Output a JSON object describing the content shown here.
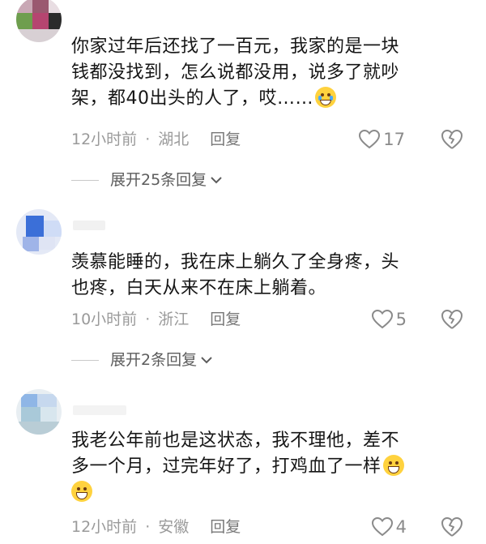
{
  "comments": [
    {
      "text_lines": [
        "你家过年后还找了一百元，我家的是一块",
        "钱都没找到，怎么说都没用，说多了就吵",
        "架，都40出头的人了，哎……"
      ],
      "time": "12小时前",
      "location": "湖北",
      "reply_label": "回复",
      "likes": "17",
      "expand_label": "展开25条回复"
    },
    {
      "text_lines": [
        "羡慕能睡的，我在床上躺久了全身疼，头",
        "也疼，白天从来不在床上躺着。"
      ],
      "time": "10小时前",
      "location": "浙江",
      "reply_label": "回复",
      "likes": "5",
      "expand_label": "展开2条回复"
    },
    {
      "text_lines": [
        "我老公年前也是这状态，我不理他，差不",
        "多一个月，过完年好了，打鸡血了一样"
      ],
      "time": "12小时前",
      "location": "安徽",
      "reply_label": "回复",
      "likes": "4"
    }
  ],
  "colors": {
    "text": "#161616",
    "meta": "#9a9a9a",
    "emoji": "#ffd23e"
  },
  "icons": [
    "heart-icon",
    "broken-heart-icon",
    "chevron-down-icon",
    "crying-emoji",
    "grinning-emoji"
  ]
}
